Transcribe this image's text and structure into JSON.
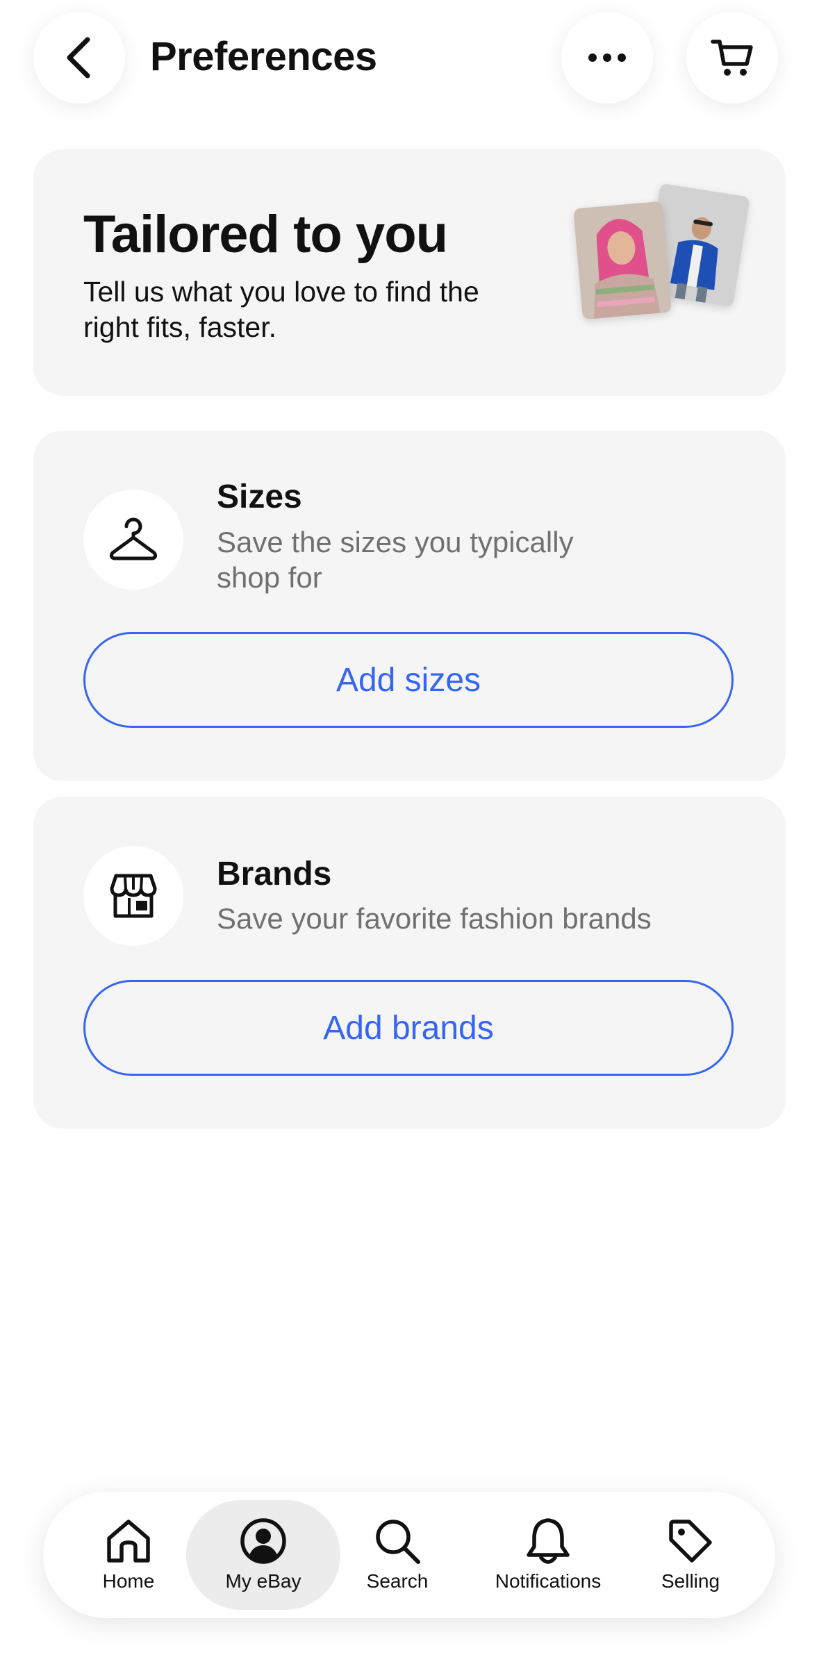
{
  "header": {
    "title": "Preferences"
  },
  "hero": {
    "title": "Tailored to you",
    "description": "Tell us what you love to find the right fits, faster."
  },
  "sizes": {
    "title": "Sizes",
    "description": "Save the sizes you typically shop for",
    "button_label": "Add sizes",
    "icon": "hanger-icon"
  },
  "brands": {
    "title": "Brands",
    "description": "Save your favorite fashion brands",
    "button_label": "Add brands",
    "icon": "storefront-icon"
  },
  "nav": {
    "items": [
      {
        "label": "Home",
        "icon": "home-icon"
      },
      {
        "label": "My eBay",
        "icon": "account-icon",
        "active": true
      },
      {
        "label": "Search",
        "icon": "search-icon"
      },
      {
        "label": "Notifications",
        "icon": "bell-icon"
      },
      {
        "label": "Selling",
        "icon": "tag-icon"
      }
    ]
  },
  "colors": {
    "accent": "#3665f3",
    "card_bg": "#f5f5f5",
    "muted_text": "#707070"
  }
}
